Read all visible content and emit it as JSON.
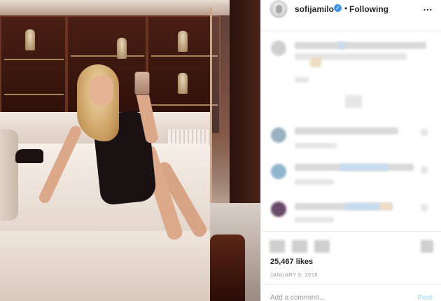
{
  "post": {
    "username": "sofijamilo",
    "verified_icon": "verified-badge-icon",
    "separator": "•",
    "follow_state": "Following",
    "more_icon": "…",
    "likes": "25,467 likes",
    "date": "JANUARY 6, 2019",
    "comment_placeholder": "Add a comment...",
    "post_label": "Post"
  },
  "colors": {
    "verified": "#3897f0",
    "post_disabled": "#b2dffc",
    "muted": "#999999"
  }
}
